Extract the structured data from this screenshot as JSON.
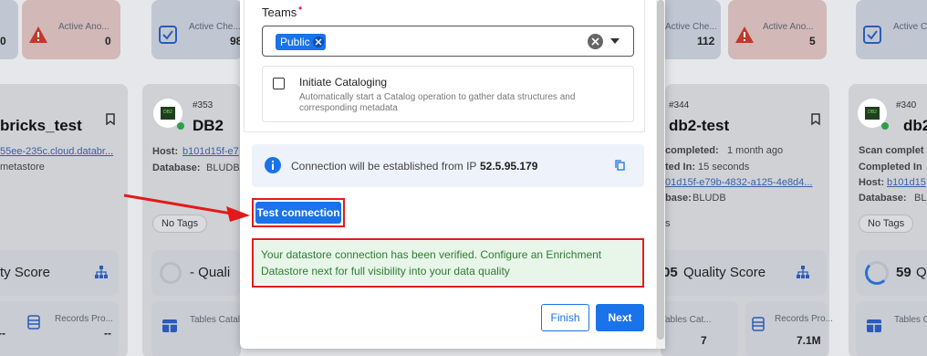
{
  "background": {
    "stats": [
      {
        "label": "Active Ano...",
        "value": "0"
      },
      {
        "label": "Active Che...",
        "value": "98"
      },
      {
        "label": "Active Che...",
        "value": "112"
      },
      {
        "label": "Active Ano...",
        "value": "5"
      },
      {
        "label": "Active Che...",
        "value": ""
      },
      {
        "label": "",
        "value": "0"
      }
    ],
    "cards": [
      {
        "title": "bricks_test",
        "host": "55ee-235c.cloud.databr...",
        "db": "metastore",
        "tag": "No Tags",
        "quality": "ty Score"
      },
      {
        "number": "#353",
        "title": "DB2",
        "host_label": "Host:",
        "host": "b101d15f-e7",
        "db_label": "Database:",
        "db": "BLUDB",
        "tag": "No Tags",
        "quality": "- Quali"
      },
      {
        "number": "#344",
        "title": "db2-test",
        "scan_label": "completed:",
        "scan": "1 month ago",
        "dur_label": "ted In:",
        "dur": "15 seconds",
        "host": "01d15f-e79b-4832-a125-4e8d4...",
        "db_label": "base:",
        "db": "BLUDB",
        "tag": "s",
        "quality_score": "05",
        "quality": "Quality Score"
      },
      {
        "number": "#340",
        "title": "db2",
        "scan_label": "Scan complet",
        "dur_label": "Completed In",
        "host_label": "Host:",
        "host": "b101d15",
        "db_label": "Database:",
        "db": "BLUDB",
        "tag": "No Tags",
        "quality_score": "59",
        "quality": "Q"
      }
    ],
    "bottom": [
      {
        "label": "",
        "value": "--"
      },
      {
        "label": "Records Pro...",
        "value": "--"
      },
      {
        "label": "Tables Catal...",
        "value": ""
      },
      {
        "label": "Tables Cat...",
        "value": "7"
      },
      {
        "label": "Records Pro...",
        "value": "7.1M"
      },
      {
        "label": "Tables Cat...",
        "value": ""
      }
    ]
  },
  "modal": {
    "teams_label": "Teams",
    "required_mark": "•",
    "team_chip": "Public",
    "catalog_label": "Initiate Cataloging",
    "catalog_desc_1": "Automatically start a Catalog operation to gather data structures and",
    "catalog_desc_2": "corresponding metadata",
    "ip_text": "Connection will be established from IP",
    "ip_value": "52.5.95.179",
    "test_button": "Test connection",
    "success_line_1": "Your datastore connection has been verified. Configure an Enrichment",
    "success_line_2": "Datastore next for full visibility into your data quality",
    "finish_button": "Finish",
    "next_button": "Next"
  },
  "colors": {
    "primary": "#1a73e8",
    "success_bg": "#e8f5e9",
    "success_text": "#2e7d32",
    "annotation_red": "#e31a1a",
    "info_bg": "#eef2fb"
  }
}
